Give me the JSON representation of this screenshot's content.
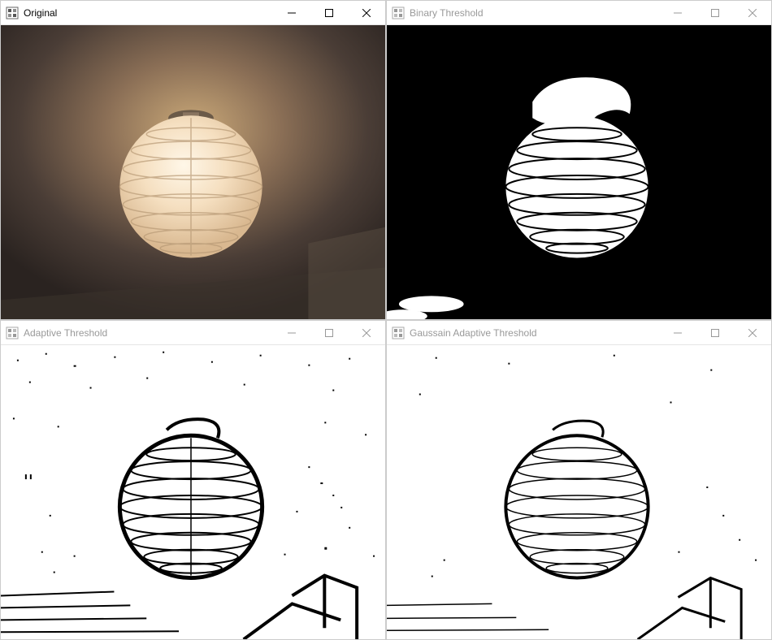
{
  "windows": [
    {
      "id": "original",
      "title": "Original",
      "active": true
    },
    {
      "id": "binary",
      "title": "Binary Threshold",
      "active": false
    },
    {
      "id": "adaptive",
      "title": "Adaptive Threshold",
      "active": false
    },
    {
      "id": "gaussian",
      "title": "Gaussain Adaptive Threshold",
      "active": false
    }
  ],
  "app_icon": "opencv-highgui-icon"
}
